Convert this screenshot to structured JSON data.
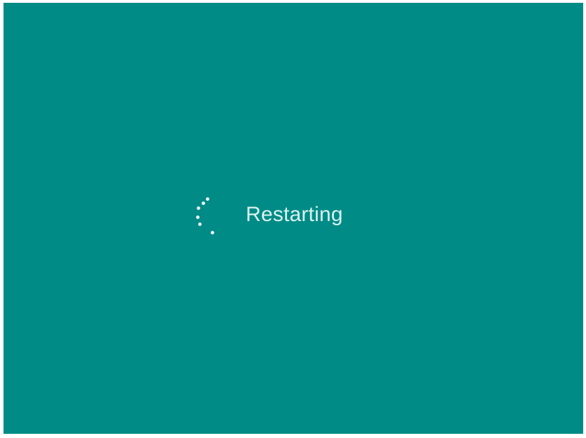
{
  "screen": {
    "background_color": "#008b86",
    "text_color": "#d9f2ef",
    "status_text": "Restarting"
  },
  "spinner": {
    "icon": "loading-dots-icon"
  }
}
